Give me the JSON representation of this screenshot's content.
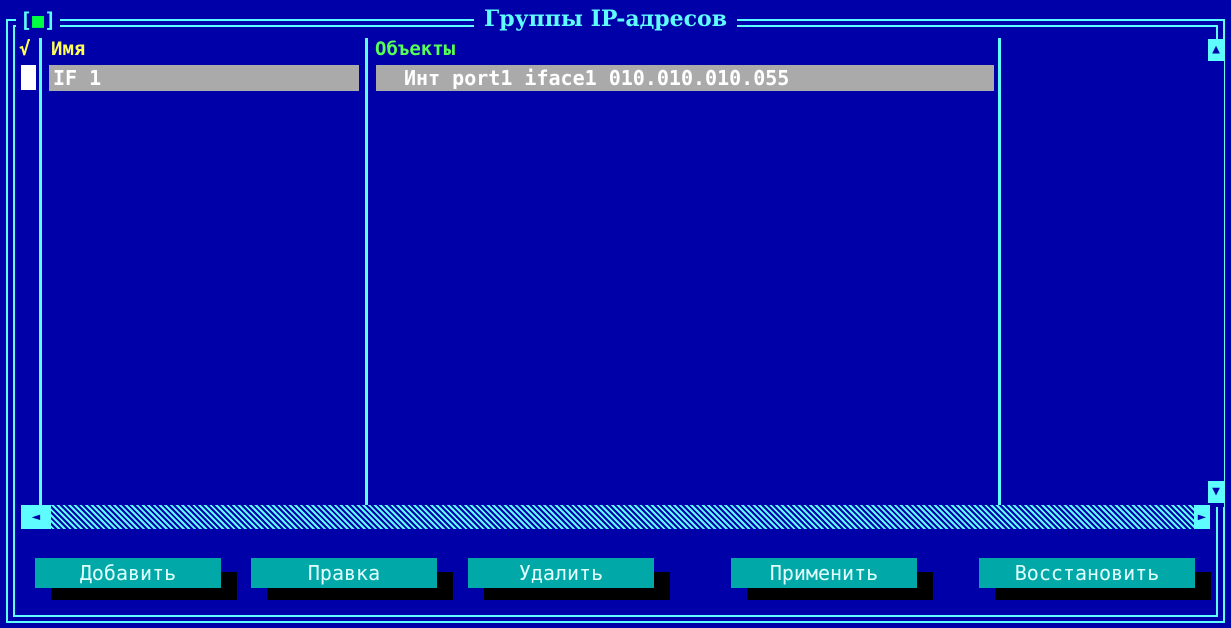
{
  "window": {
    "title": "Группы IP-адресов",
    "close_mark": "■"
  },
  "list": {
    "check_mark": "√",
    "columns": {
      "name": "Имя",
      "objects": "Объекты"
    },
    "selected_row": {
      "name": "IF 1",
      "object": "Инт port1 iface1 010.010.010.055"
    }
  },
  "scrollbar": {
    "up_arrow": "▲",
    "down_arrow": "▼",
    "left_arrow": "◄",
    "right_arrow": "►"
  },
  "buttons": {
    "add": "Добавить",
    "edit": "Правка",
    "delete": "Удалить",
    "apply": "Применить",
    "restore": "Восстановить"
  },
  "colors": {
    "background": "#0000a8",
    "frame": "#5ffcff",
    "header_name": "#ffff55",
    "header_objects": "#55ff55",
    "selection": "#aaaaaa",
    "button": "#00a8a8"
  },
  "icons": {
    "close": "close-box-icon",
    "check": "checkmark-icon",
    "scroll_up": "arrow-up-icon",
    "scroll_down": "arrow-down-icon",
    "scroll_left": "arrow-left-icon",
    "scroll_right": "arrow-right-icon"
  }
}
